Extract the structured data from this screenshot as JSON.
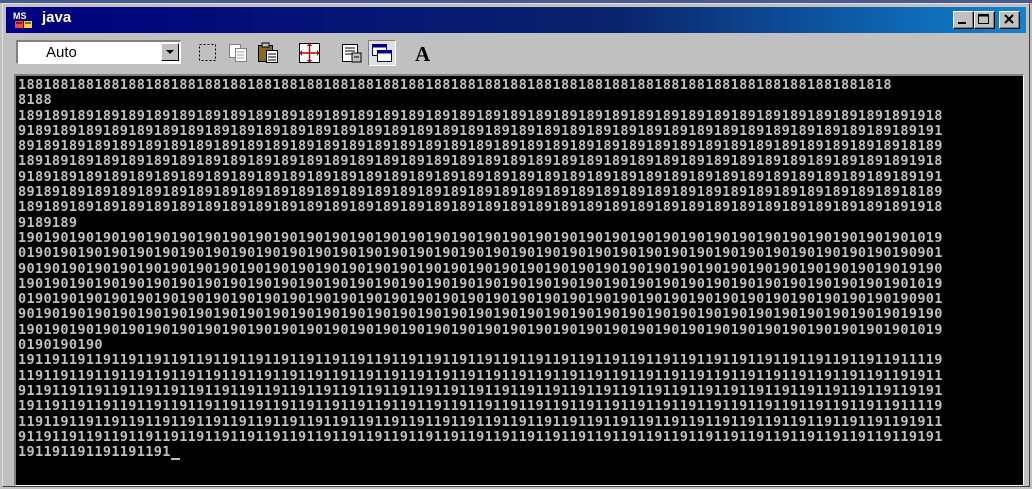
{
  "window": {
    "title": "java",
    "icon": "ms-dos-icon"
  },
  "title_buttons": [
    "minimize-icon",
    "maximize-icon",
    "close-icon"
  ],
  "toolbar": {
    "font_size_selector": {
      "selected": "Auto"
    },
    "buttons": [
      {
        "name": "mark-button",
        "icon": "dotted-rectangle-icon"
      },
      {
        "name": "copy-button",
        "icon": "copy-icon"
      },
      {
        "name": "paste-button",
        "icon": "paste-icon"
      },
      {
        "name": "full-screen-button",
        "icon": "full-screen-icon"
      },
      {
        "name": "properties-button",
        "icon": "properties-icon"
      },
      {
        "name": "background-button",
        "icon": "windows-icon",
        "pressed": true
      },
      {
        "name": "font-button",
        "icon": "font-a-icon"
      }
    ]
  },
  "console": {
    "text": "1881881881881881881881881881881881881881881881881881881881881881881881881881881881881881881881881881818\n8188\n1891891891891891891891891891891891891891891891891891891891891891891891891891891891891891891891891891891891918\n9189189189189189189189189189189189189189189189189189189189189189189189189189189189189189189189189189189189191\n8918918918918918918918918918918918918918918918918918918918918918918918918918918918918918918918918918918918189\n1891891891891891891891891891891891891891891891891891891891891891891891891891891891891891891891891891891891918\n9189189189189189189189189189189189189189189189189189189189189189189189189189189189189189189189189189189189191\n8918918918918918918918918918918918918918918918918918918918918918918918918918918918918918918918918918918918189\n1891891891891891891891891891891891891891891891891891891891891891891891891891891891891891891891891891891891918\n9189189\n1901901901901901901901901901901901901901901901901901901901901901901901901901901901901901901901901901901901019\n0190190190190190190190190190190190190190190190190190190190190190190190190190190190190190190190190190190190901\n9019019019019019019019019019019019019019019019019019019019019019019019019019019019019019019019019019019019190\n1901901901901901901901901901901901901901901901901901901901901901901901901901901901901901901901901901901901019\n0190190190190190190190190190190190190190190190190190190190190190190190190190190190190190190190190190190190901\n9019019019019019019019019019019019019019019019019019019019019019019019019019019019019019019019019019019019190\n1901901901901901901901901901901901901901901901901901901901901901901901901901901901901901901901901901901901019\n0190190190\n1911911911911911911911911911911911911911911911911911911911911911911911911911911911911911911911911911911911119\n1191191191191191191191191191191191191191191191191191191191191191191191191191191191191191191191191191191191911\n9119119119119119119119119119119119119119119119119119119119119119119119119119119119119119119119119119119119191\n1911911911911911911911911911911911911911911911911911911911911911911911911911911911911911911911911911911911119\n1191191191191191191191191191191191191191191191191191191191191191191191191191191191191191191191191191191191911\n9119119119119119119119119119119119119119119119119119119119119119119119119119119119119119119119119119119119191\n191191191191191191"
  }
}
